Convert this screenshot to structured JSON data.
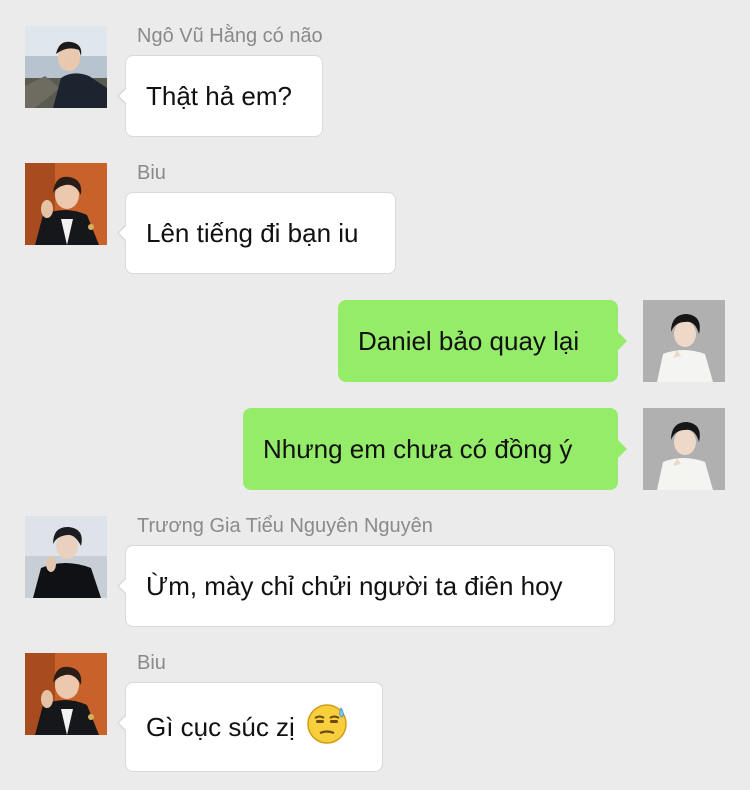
{
  "messages": [
    {
      "sender": "Ngô Vũ Hằng có não",
      "text": "Thật hả em?",
      "side": "left",
      "avatar_icon": "avatar-man-dark-jacket"
    },
    {
      "sender": "Biu",
      "text": "Lên tiếng đi bạn iu",
      "side": "left",
      "avatar_icon": "avatar-man-suit-orange"
    },
    {
      "sender": "",
      "text": "Daniel bảo quay lại",
      "side": "right",
      "avatar_icon": "avatar-man-white-sweater"
    },
    {
      "sender": "",
      "text": "Nhưng em chưa có đồng ý",
      "side": "right",
      "avatar_icon": "avatar-man-white-sweater"
    },
    {
      "sender": "Trương Gia Tiểu Nguyên Nguyên",
      "text": "Ừm, mày chỉ chửi người ta điên hoy",
      "side": "left",
      "avatar_icon": "avatar-man-black-outfit"
    },
    {
      "sender": "Biu",
      "text": "Gì cục súc zị",
      "side": "left",
      "avatar_icon": "avatar-man-suit-orange",
      "emoji": "sweat-unamused-emoji"
    }
  ],
  "colors": {
    "background": "#ebebeb",
    "incoming_bubble": "#ffffff",
    "outgoing_bubble": "#95ec69",
    "sender_name": "#8a8a8a"
  }
}
